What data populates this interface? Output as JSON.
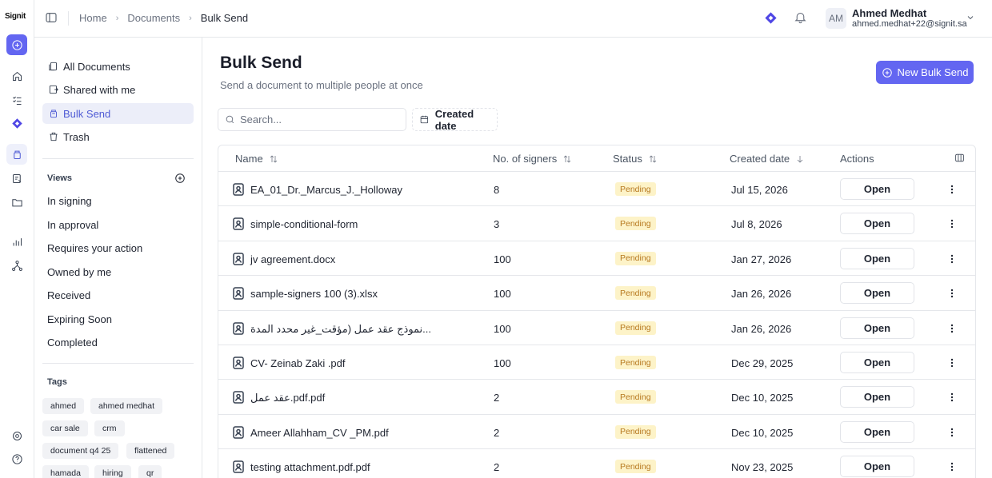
{
  "brand": {
    "logo_text": "Signit",
    "accent": "#6366f1"
  },
  "breadcrumb": {
    "items": [
      "Home",
      "Documents",
      "Bulk Send"
    ]
  },
  "user": {
    "initials": "AM",
    "name": "Ahmed Medhat",
    "email": "ahmed.medhat+22@signit.sa"
  },
  "sidebar": {
    "documents": [
      {
        "label": "All Documents",
        "icon": "documents-icon"
      },
      {
        "label": "Shared with me",
        "icon": "share-icon"
      },
      {
        "label": "Bulk Send",
        "icon": "bulk-send-icon",
        "active": true
      },
      {
        "label": "Trash",
        "icon": "trash-icon"
      }
    ],
    "views_title": "Views",
    "views": [
      "In signing",
      "In approval",
      "Requires your action",
      "Owned by me",
      "Received",
      "Expiring Soon",
      "Completed"
    ],
    "tags_title": "Tags",
    "tags": [
      "ahmed",
      "ahmed medhat",
      "car sale",
      "crm",
      "document q4 25",
      "flattened",
      "hamada",
      "hiring",
      "qr"
    ]
  },
  "page": {
    "title": "Bulk Send",
    "subtitle": "Send a document to multiple people at once",
    "new_button": "New Bulk Send",
    "search_placeholder": "Search...",
    "date_filter": "Created date"
  },
  "table": {
    "columns": [
      "Name",
      "No. of signers",
      "Status",
      "Created date",
      "Actions"
    ],
    "rows": [
      {
        "name": "EA_01_Dr._Marcus_J._Holloway",
        "signers": "8",
        "status": "Pending",
        "date": "Jul 15, 2026",
        "action": "Open"
      },
      {
        "name": "simple-conditional-form",
        "signers": "3",
        "status": "Pending",
        "date": "Jul 8, 2026",
        "action": "Open"
      },
      {
        "name": "jv agreement.docx",
        "signers": "100",
        "status": "Pending",
        "date": "Jan 27, 2026",
        "action": "Open"
      },
      {
        "name": "sample-signers 100 (3).xlsx",
        "signers": "100",
        "status": "Pending",
        "date": "Jan 26, 2026",
        "action": "Open"
      },
      {
        "name": "نموذج عقد عمل (مؤقت_غير محدد المدة...",
        "signers": "100",
        "status": "Pending",
        "date": "Jan 26, 2026",
        "action": "Open"
      },
      {
        "name": "CV- Zeinab Zaki .pdf",
        "signers": "100",
        "status": "Pending",
        "date": "Dec 29, 2025",
        "action": "Open"
      },
      {
        "name": "عقد عمل.pdf.pdf",
        "signers": "2",
        "status": "Pending",
        "date": "Dec 10, 2025",
        "action": "Open"
      },
      {
        "name": "Ameer Allahham_CV _PM.pdf",
        "signers": "2",
        "status": "Pending",
        "date": "Dec 10, 2025",
        "action": "Open"
      },
      {
        "name": "testing attachment.pdf.pdf",
        "signers": "2",
        "status": "Pending",
        "date": "Nov 23, 2025",
        "action": "Open"
      }
    ]
  }
}
